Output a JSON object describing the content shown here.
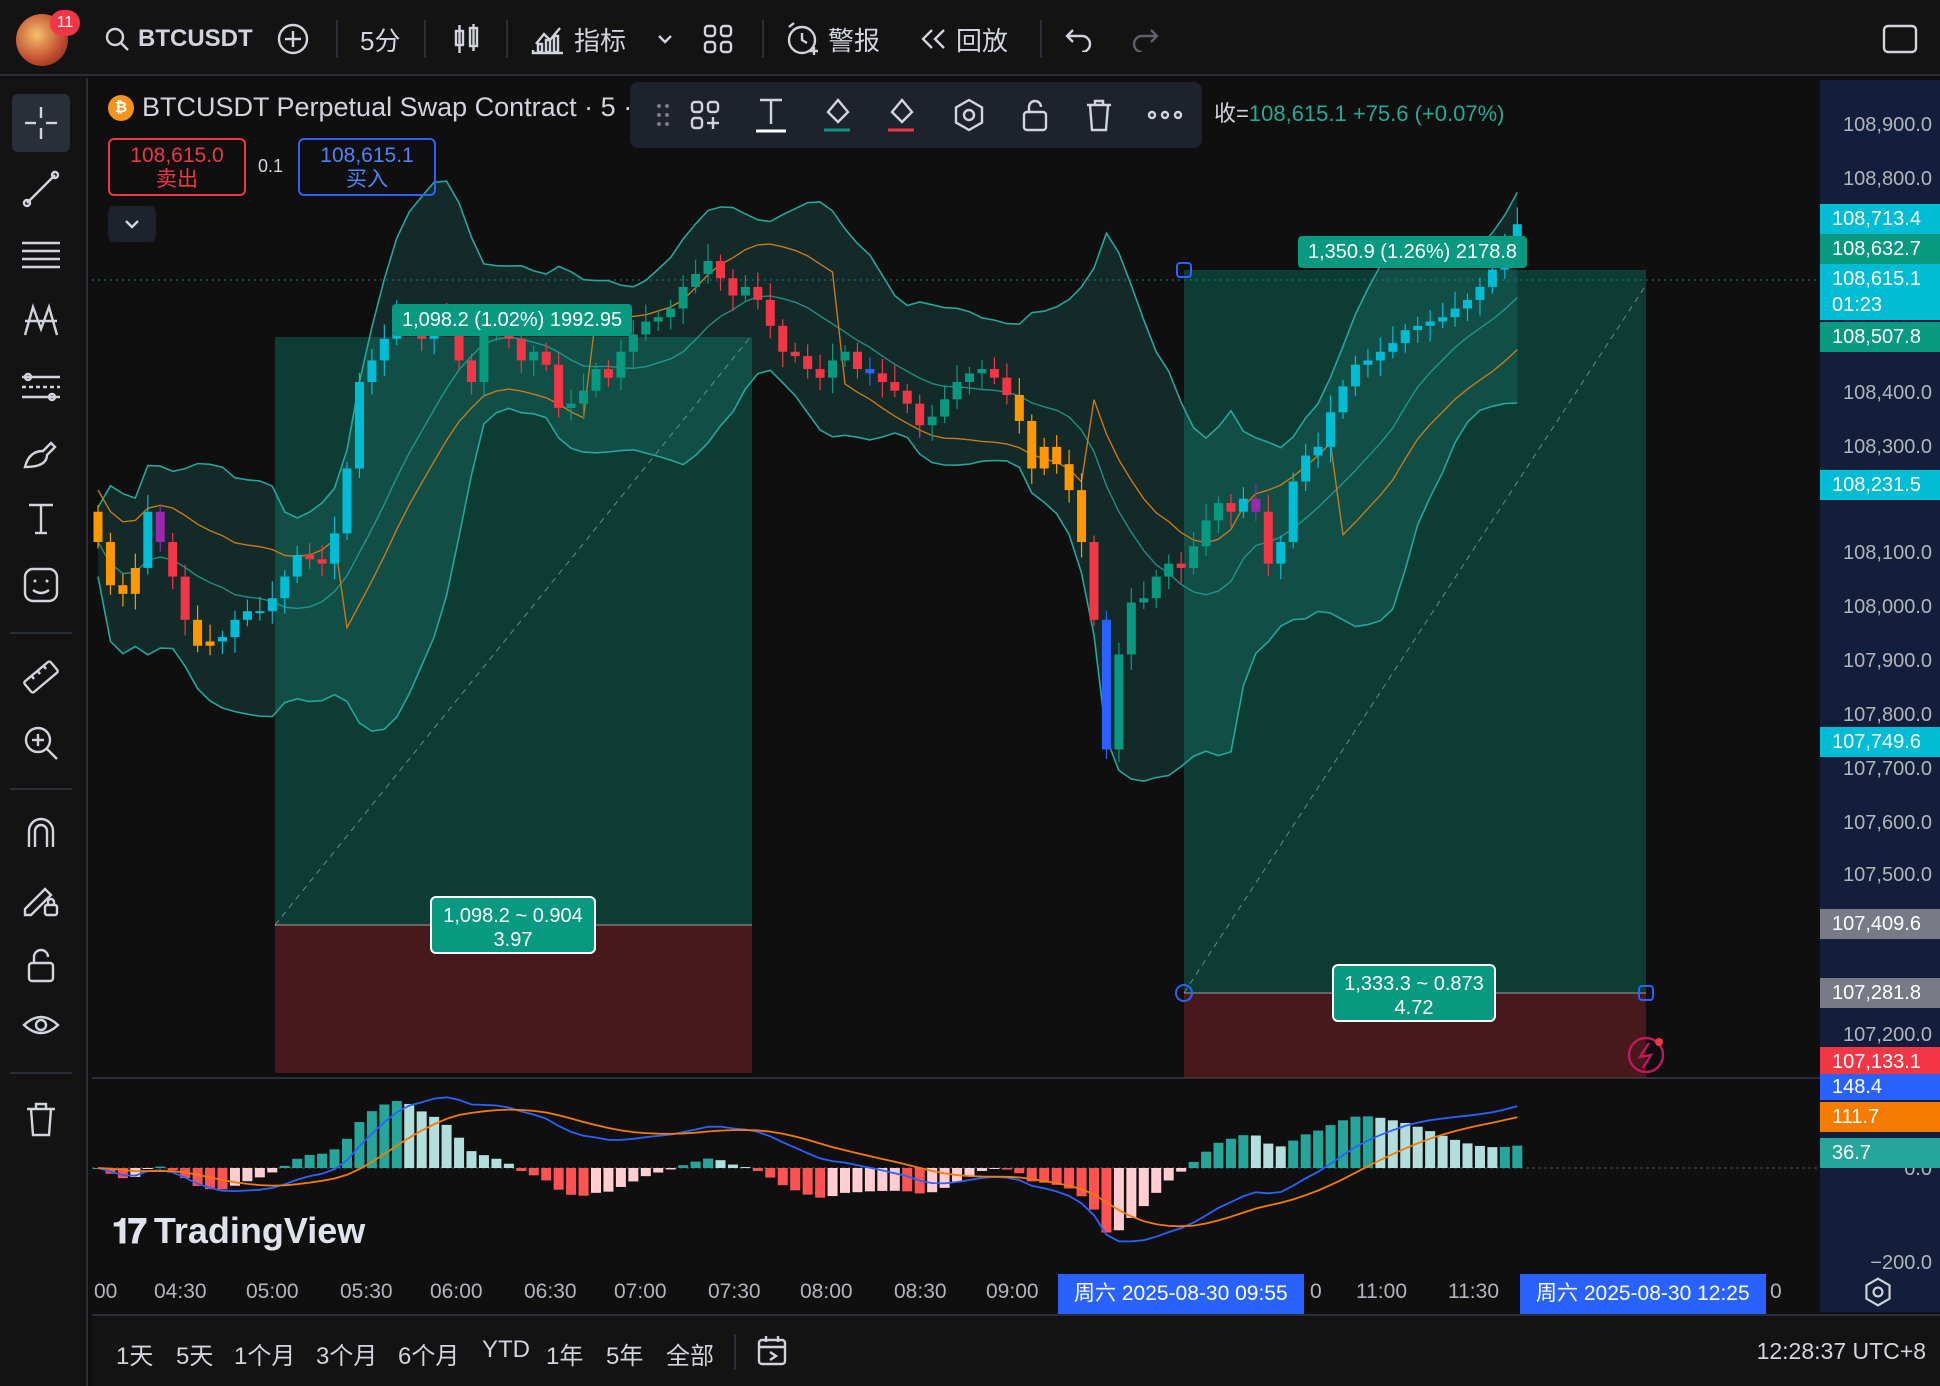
{
  "topbar": {
    "avatar_badge": "11",
    "symbol": "BTCUSDT",
    "interval": "5分",
    "indicators": "指标",
    "alerts": "警报",
    "replay": "回放"
  },
  "chart": {
    "title": "BTCUSDT Perpetual Swap Contract · 5 ·",
    "ohlc_label": "收=",
    "ohlc_value": "108,615.1 +75.6 (+0.07%)",
    "sell_price": "108,615.0",
    "sell_label": "卖出",
    "spread": "0.1",
    "buy_price": "108,615.1",
    "buy_label": "买入",
    "watermark": "TradingView"
  },
  "price_axis": {
    "labels": [
      "108,900.0",
      "108,800.0",
      "108,400.0",
      "108,300.0",
      "108,100.0",
      "108,000.0",
      "107,900.0",
      "107,800.0",
      "107,700.0",
      "107,600.0",
      "107,500.0",
      "107,200.0",
      "0.0",
      "−200.0"
    ],
    "tags": [
      {
        "text": "108,713.4",
        "color": "#00bcd4"
      },
      {
        "text": "108,632.7",
        "color": "#089981"
      },
      {
        "text": "108,615.1",
        "color": "#00bcd4"
      },
      {
        "text": "01:23",
        "color": "#00bcd4"
      },
      {
        "text": "108,507.8",
        "color": "#089981"
      },
      {
        "text": "108,231.5",
        "color": "#00bcd4"
      },
      {
        "text": "107,749.6",
        "color": "#00bcd4"
      },
      {
        "text": "107,409.6",
        "color": "#787b86"
      },
      {
        "text": "107,281.8",
        "color": "#787b86"
      },
      {
        "text": "107,133.1",
        "color": "#f23645"
      },
      {
        "text": "148.4",
        "color": "#2962ff"
      },
      {
        "text": "111.7",
        "color": "#f57c00"
      },
      {
        "text": "36.7",
        "color": "#26a69a"
      }
    ]
  },
  "positions": {
    "p1_top": "1,098.2 (1.02%) 1992.95",
    "p1_bottom_line1": "1,098.2 ~ 0.904",
    "p1_bottom_line2": "3.97",
    "p2_top": "1,350.9 (1.26%) 2178.8",
    "p2_bottom_line1": "1,333.3 ~ 0.873",
    "p2_bottom_line2": "4.72"
  },
  "time_axis": {
    "labels": [
      "00",
      "04:30",
      "05:00",
      "05:30",
      "06:00",
      "06:30",
      "07:00",
      "07:30",
      "08:00",
      "08:30",
      "09:00",
      "0",
      "11:00",
      "11:30",
      "0"
    ],
    "highlight1": "周六 2025-08-30   09:55",
    "highlight2": "周六 2025-08-30   12:25"
  },
  "bottombar": {
    "ranges": [
      "1天",
      "5天",
      "1个月",
      "3个月",
      "6个月",
      "YTD",
      "1年",
      "5年",
      "全部"
    ],
    "clock": "12:28:37 UTC+8"
  },
  "colors": {
    "up": "#089981",
    "down": "#f23645",
    "cyan": "#00bcd4",
    "orange": "#ff9800",
    "blue": "#2962ff",
    "purple": "#9c27b0"
  }
}
